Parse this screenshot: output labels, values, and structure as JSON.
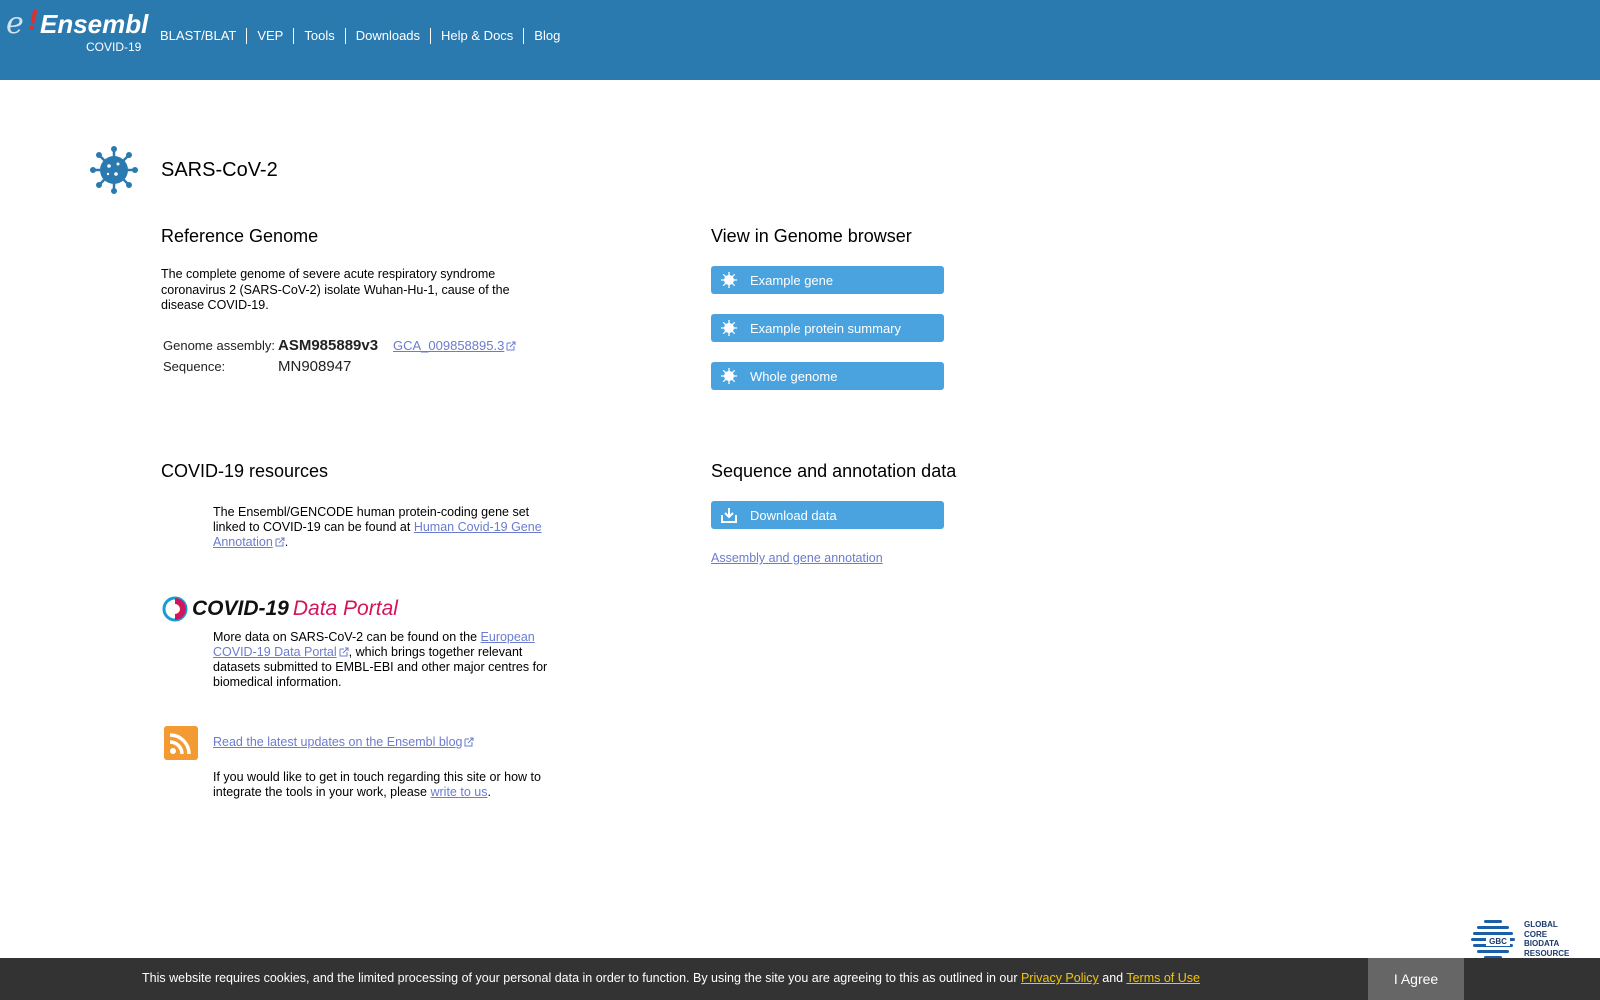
{
  "header": {
    "logo": {
      "text": "Ensembl",
      "sub": "COVID-19"
    },
    "tabs": [
      "BLAST/BLAT",
      "VEP",
      "Tools",
      "Downloads",
      "Help & Docs",
      "Blog"
    ]
  },
  "species": {
    "title": "SARS-CoV-2"
  },
  "reference_genome": {
    "heading": "Reference Genome",
    "description": "The complete genome of severe acute respiratory syndrome coronavirus 2 (SARS-CoV-2) isolate Wuhan-Hu-1, cause of the disease COVID-19.",
    "assembly_label": "Genome assembly:",
    "assembly_value": "ASM985889v3",
    "assembly_link": "GCA_009858895.3",
    "sequence_label": "Sequence:",
    "sequence_value": "MN908947"
  },
  "genome_browser": {
    "heading": "View in Genome browser",
    "buttons": [
      "Example gene",
      "Example protein summary",
      "Whole genome"
    ]
  },
  "covid_resources": {
    "heading": "COVID-19 resources",
    "gencode_text_1": "The Ensembl/GENCODE human protein-coding gene set linked to COVID-19 can be found at ",
    "gencode_link": "Human Covid-19 Gene Annotation",
    "gencode_text_2": ".",
    "portal_logo_1": "COVID-19",
    "portal_logo_2": "Data Portal",
    "portal_text_1": "More data on SARS-CoV-2 can be found on the ",
    "portal_link": "European COVID-19 Data Portal",
    "portal_text_2": ", which brings together relevant datasets submitted to EMBL-EBI and other major centres for biomedical information.",
    "blog_link": "Read the latest updates on the Ensembl blog",
    "contact_text_1": "If you would like to get in touch regarding this site or how to integrate the tools in your work, please ",
    "contact_link": "write to us",
    "contact_text_2": "."
  },
  "sequence_data": {
    "heading": "Sequence and annotation data",
    "download_button": "Download data",
    "assembly_link": "Assembly and gene annotation"
  },
  "gbc": {
    "line1": "GLOBAL",
    "line2": "CORE",
    "line3": "BIODATA",
    "line4": "RESOURCE",
    "badge": "GBC"
  },
  "cookie": {
    "message": "This website requires cookies, and the limited processing of your personal data in order to function. By using the site you are agreeing to this as outlined in our ",
    "privacy_link": "Privacy Policy",
    "and": " and ",
    "terms_link": "Terms of Use",
    "agree_button": "I Agree"
  },
  "colors": {
    "header": "#2a7ab0",
    "button": "#4aa3df",
    "link": "#6b7ccf",
    "cookie_bg": "#333333",
    "cookie_link": "#f1c40f"
  },
  "icons": {
    "virus": "virus-icon",
    "external": "external-link-icon",
    "download": "download-icon",
    "rss": "rss-icon"
  }
}
